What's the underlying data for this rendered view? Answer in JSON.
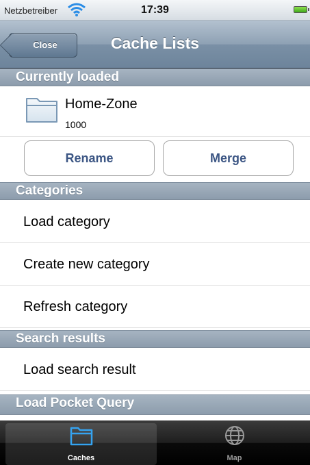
{
  "status_bar": {
    "carrier": "Netzbetreiber",
    "time": "17:39"
  },
  "navbar": {
    "title": "Cache Lists",
    "back_label": "Close"
  },
  "sections": {
    "currently_loaded": "Currently loaded",
    "categories": "Categories",
    "search_results": "Search results",
    "pocket_query": "Load Pocket Query"
  },
  "loaded": {
    "name": "Home-Zone",
    "count": "1000",
    "icon": "folder-icon"
  },
  "actions": {
    "rename": "Rename",
    "merge": "Merge"
  },
  "category_items": [
    "Load category",
    "Create new category",
    "Refresh category"
  ],
  "search_items": [
    "Load search result"
  ],
  "tabs": [
    {
      "label": "Caches",
      "icon": "folder-icon",
      "selected": true
    },
    {
      "label": "Map",
      "icon": "globe-icon",
      "selected": false
    }
  ],
  "colors": {
    "accent_text": "#3c5684",
    "header_bg": "#8c9cac",
    "selected_icon": "#2f9be8"
  }
}
